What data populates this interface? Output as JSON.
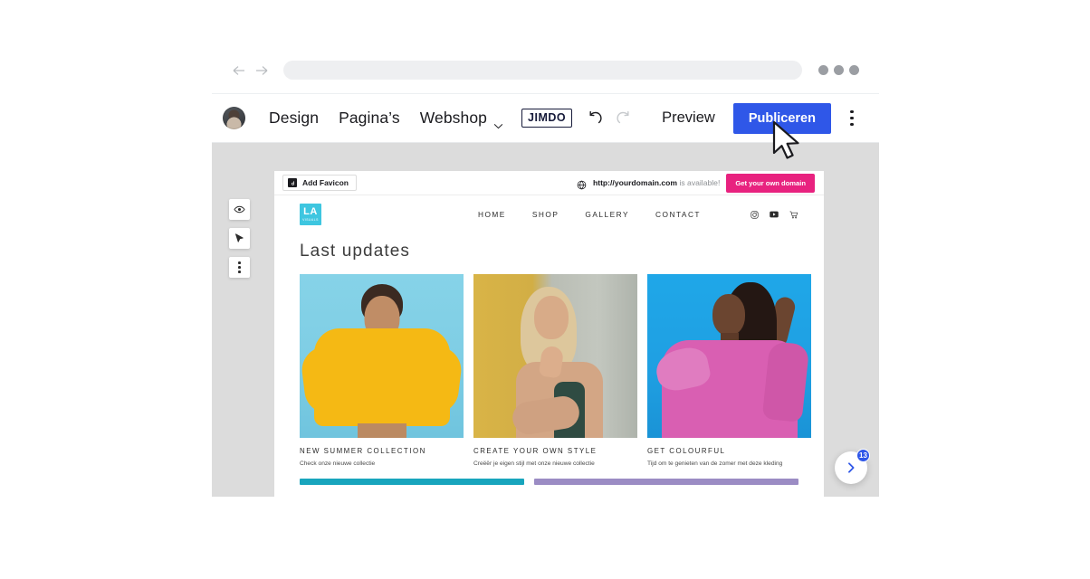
{
  "browser": {
    "back_icon": "arrow-left-icon",
    "forward_icon": "arrow-right-icon",
    "url_value": "",
    "url_placeholder": ""
  },
  "editor_toolbar": {
    "avatar": "user-avatar",
    "items": [
      {
        "label": "Design",
        "caret": false
      },
      {
        "label": "Pagina’s",
        "caret": false
      },
      {
        "label": "Webshop",
        "caret": true
      }
    ],
    "brand_logo": "JIMDO",
    "undo_icon": "undo-icon",
    "redo_icon": "redo-icon",
    "preview_label": "Preview",
    "publish_label": "Publiceren",
    "publish_color": "#2f57e8",
    "more_icon": "kebab-menu-icon"
  },
  "tool_rail": {
    "items": [
      {
        "name": "eye-icon"
      },
      {
        "name": "cursor-icon"
      },
      {
        "name": "more-vertical-icon"
      }
    ]
  },
  "domain_bar": {
    "favicon_label": "Add Favicon",
    "globe_icon": "globe-icon",
    "domain": "http://yourdomain.com",
    "availability": " is available!",
    "cta_label": "Get your own domain",
    "cta_color": "#e8227f"
  },
  "site": {
    "logo": {
      "main": "LA",
      "sub": "VISUALS",
      "color": "#3ec6e0"
    },
    "nav_links": [
      "HOME",
      "SHOP",
      "GALLERY",
      "CONTACT"
    ],
    "nav_icons": [
      "instagram-icon",
      "youtube-icon",
      "shopping-cart-icon"
    ],
    "heading": "Last updates",
    "cards": [
      {
        "title": "NEW SUMMER COLLECTION",
        "desc": "Check onze nieuwe collectie",
        "image": "woman-in-yellow-hoodie-on-light-blue-background"
      },
      {
        "title": "CREATE YOUR OWN STYLE",
        "desc": "Creëër je eigen stijl met onze nieuwe collectie",
        "image": "blonde-woman-against-yellow-and-grey-wall"
      },
      {
        "title": "GET COLOURFUL",
        "desc": "Tijd om te genieten van de zomer met deze kleding",
        "image": "woman-in-pink-dress-on-blue-background"
      }
    ],
    "color_bars": [
      {
        "name": "teal-bar",
        "color": "#18a5bd"
      },
      {
        "name": "purple-bar",
        "color": "#9b8cc4"
      }
    ]
  },
  "chat_widget": {
    "icon": "chevron-right-icon",
    "badge_count": "13",
    "color": "#2f57e8"
  },
  "cursor": {
    "name": "mouse-pointer"
  }
}
